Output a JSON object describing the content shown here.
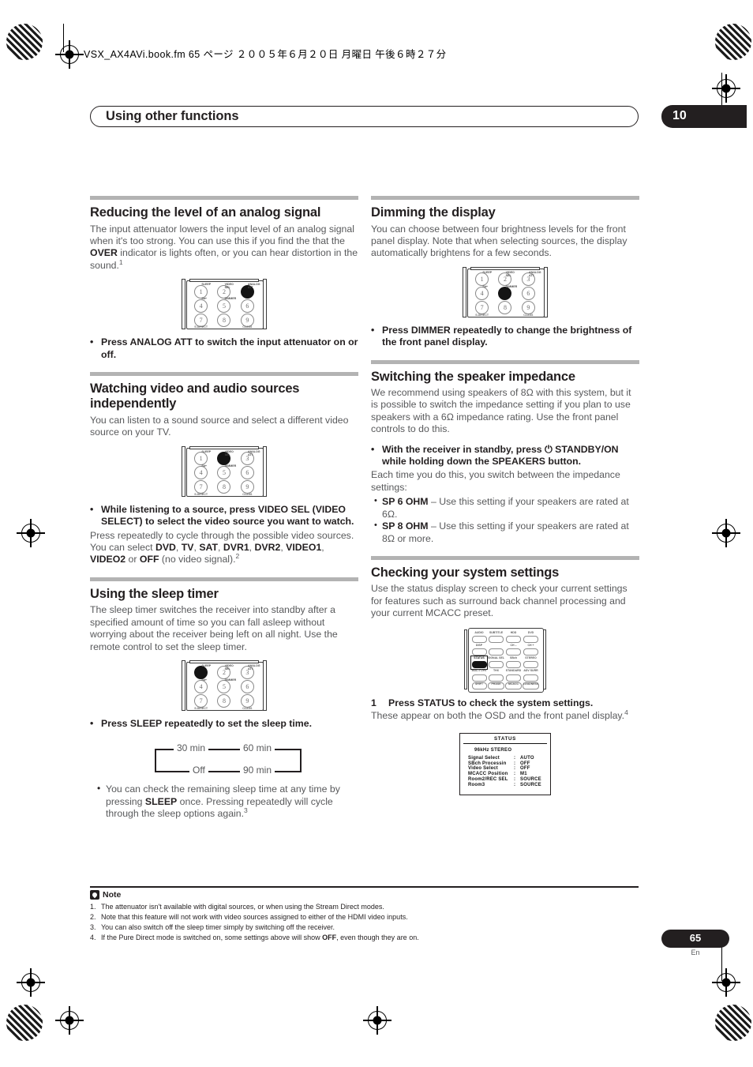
{
  "file_header": "VSX_AX4AVi.book.fm  65 ページ  ２００５年６月２０日  月曜日  午後６時２７分",
  "chapter": {
    "title": "Using other functions",
    "number": "10"
  },
  "page": {
    "number": "65",
    "language": "En"
  },
  "left_column": {
    "s1": {
      "heading": "Reducing the level of an analog signal",
      "body_a": "The input attenuator lowers the input level of an analog signal when it's too strong. You can use this if you find the that the ",
      "body_bold": "OVER",
      "body_b": " indicator is lights often, or you can hear distortion in the sound.",
      "footnote_ref": "1",
      "bullet": "Press ANALOG ATT to switch the input attenuator on or off.",
      "remote": {
        "highlight_key": "3",
        "keys": [
          {
            "n": "1",
            "label": "SLEEP"
          },
          {
            "n": "2",
            "label": "VIDEO SEL"
          },
          {
            "n": "3",
            "label": "ANALOG ATT"
          },
          {
            "n": "4",
            "label": "Sb+"
          },
          {
            "n": "5",
            "label": "DIMMER"
          },
          {
            "n": "6",
            "label": ""
          },
          {
            "n": "7",
            "label": "S.DIRECT"
          },
          {
            "n": "8",
            "label": ""
          },
          {
            "n": "9",
            "label": "CLASS"
          }
        ]
      }
    },
    "s2": {
      "heading": "Watching video and audio sources independently",
      "body": "You can listen to a sound source and select a different video source on your TV.",
      "remote": {
        "highlight_key": "2"
      },
      "bullet_bold": "While listening to a source, press VIDEO SEL (VIDEO SELECT) to select the video source you want to watch.",
      "body_after_a": "Press repeatedly to cycle through the possible video sources. You can select ",
      "sources": [
        "DVD",
        "TV",
        "SAT",
        "DVR1",
        "DVR2",
        "VIDEO1",
        "VIDEO2",
        "OFF"
      ],
      "body_after_b": " (no video signal).",
      "footnote_ref": "2"
    },
    "s3": {
      "heading": "Using the sleep timer",
      "body": "The sleep timer switches the receiver into standby after a specified amount of time so you can fall asleep without worrying about the receiver being left on all night. Use the remote control to set the sleep timer.",
      "remote": {
        "highlight_key": "1"
      },
      "bullet": "Press SLEEP repeatedly to set the sleep time.",
      "cycle": {
        "top_left": "30 min",
        "top_right": "60 min",
        "bottom_left": "Off",
        "bottom_right": "90 min"
      },
      "sub_bullet_a": "You can check the remaining sleep time at any time by pressing ",
      "sub_bullet_bold": "SLEEP",
      "sub_bullet_b": " once. Pressing repeatedly will cycle through the sleep options again.",
      "footnote_ref": "3"
    }
  },
  "right_column": {
    "s1": {
      "heading": "Dimming the display",
      "body": "You can choose between four brightness levels for the front panel display. Note that when selecting sources, the display automatically brightens for a few seconds.",
      "remote": {
        "highlight_key": "5"
      },
      "bullet": "Press DIMMER repeatedly to change the brightness of the front panel display."
    },
    "s2": {
      "heading": "Switching the speaker impedance",
      "body": "We recommend using speakers of 8Ω with this system, but it is possible to switch the impedance setting if you plan to use speakers with a 6Ω impedance rating. Use the front panel controls to do this.",
      "bullet_bold": "With the receiver in standby, press ⏻ STANDBY/ON while holding down the SPEAKERS button.",
      "body_after": "Each time you do this, you switch between the impedance settings:",
      "options": [
        {
          "name": "SP 6 OHM",
          "desc": " – Use this setting if your speakers are rated at 6Ω."
        },
        {
          "name": "SP 8 OHM",
          "desc": " – Use this setting if your speakers are rated at 8Ω or more."
        }
      ]
    },
    "s3": {
      "heading": "Checking your system settings",
      "body": "Use the status display screen to check your current settings for features such as surround back channel processing and your current MCACC preset.",
      "remote_buttons": [
        {
          "label": "AUDIO",
          "on": false
        },
        {
          "label": "SUBTITLE",
          "on": false
        },
        {
          "label": "HDD",
          "on": false
        },
        {
          "label": "DVD",
          "on": false
        },
        {
          "label": "DISP",
          "on": false
        },
        {
          "label": "",
          "on": false
        },
        {
          "label": "CH –",
          "on": false
        },
        {
          "label": "CH +",
          "on": false
        },
        {
          "label": "STATUS",
          "on": true
        },
        {
          "label": "SIGNAL SEL",
          "on": false
        },
        {
          "label": "SBch",
          "on": false
        },
        {
          "label": "STEREO",
          "on": false
        },
        {
          "label": "MULTI OPE",
          "on": false
        },
        {
          "label": "THX",
          "on": false
        },
        {
          "label": "STANDARD",
          "on": false
        },
        {
          "label": "ADV SURR",
          "on": false
        },
        {
          "label": "SHIFT",
          "on": false
        },
        {
          "label": "PHASE",
          "on": false
        },
        {
          "label": "MCACC",
          "on": false
        },
        {
          "label": "LOUDNESS",
          "on": false
        }
      ],
      "step_num": "1",
      "step_text": "Press STATUS to check the system settings.",
      "step_body": "These appear on both the OSD and the front panel display.",
      "footnote_ref": "4",
      "osd": {
        "title": "STATUS",
        "line1": "96kHz  STEREO",
        "rows": [
          {
            "key": "Signal Select",
            "value": "AUTO"
          },
          {
            "key": "SBch Processin",
            "value": "OFF"
          },
          {
            "key": "Video Select",
            "value": "OFF"
          },
          {
            "key": "MCACC Position",
            "value": "M1"
          },
          {
            "key": "Room2/REC SEL",
            "value": "SOURCE"
          },
          {
            "key": "Room3",
            "value": "SOURCE"
          }
        ]
      }
    }
  },
  "notes": {
    "label": "Note",
    "items": [
      {
        "num": "1.",
        "text": "The attenuator isn't available with digital sources, or when using the Stream Direct modes."
      },
      {
        "num": "2.",
        "text": "Note that this feature will not work with video sources assigned to either of the HDMI video inputs."
      },
      {
        "num": "3.",
        "text": "You can also switch off the sleep timer simply by switching off the receiver."
      },
      {
        "num": "4.",
        "text_a": "If the Pure Direct mode is switched on, some settings above will show ",
        "bold": "OFF",
        "text_b": ", even though they are on."
      }
    ]
  }
}
